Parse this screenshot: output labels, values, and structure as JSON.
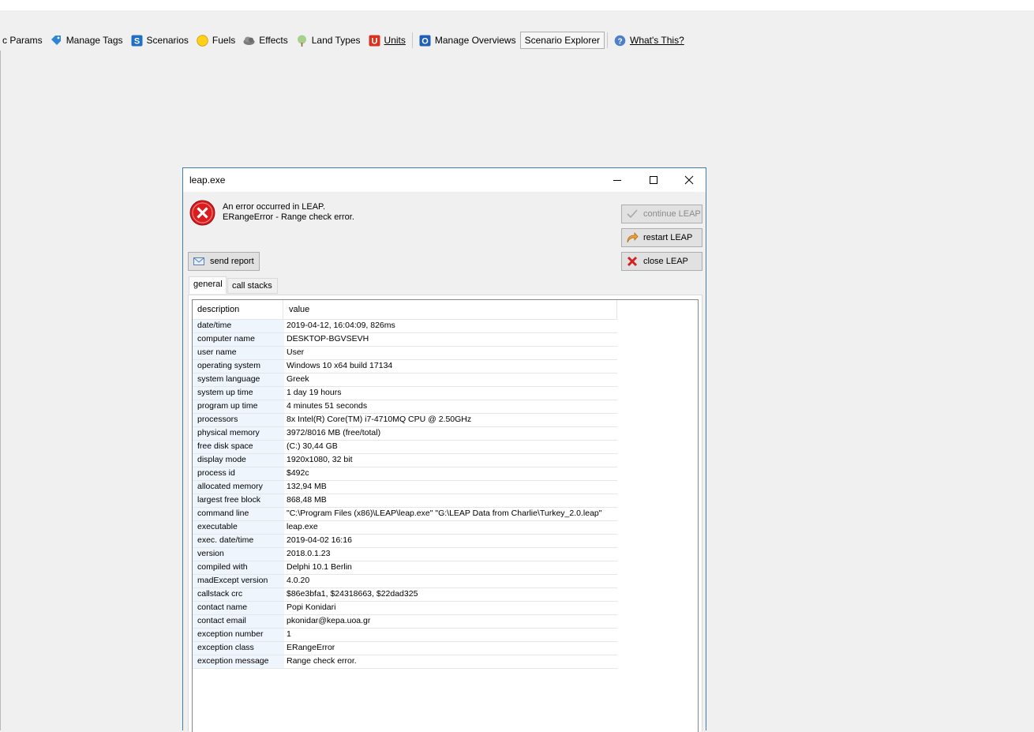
{
  "toolbar": {
    "items": [
      {
        "label": "c Params",
        "icon": "none"
      },
      {
        "label": "Manage Tags",
        "icon": "tag-icon"
      },
      {
        "label": "Scenarios",
        "icon": "scenarios-icon"
      },
      {
        "label": "Fuels",
        "icon": "fuels-icon"
      },
      {
        "label": "Effects",
        "icon": "effects-icon"
      },
      {
        "label": "Land Types",
        "icon": "tree-icon"
      },
      {
        "label": "Units",
        "icon": "units-icon"
      },
      {
        "label": "Manage Overviews",
        "icon": "overviews-icon"
      },
      {
        "label": "Scenario Explorer",
        "icon": "none"
      },
      {
        "label": "What's This?",
        "icon": "help-icon"
      }
    ]
  },
  "dialog": {
    "title": "leap.exe",
    "message_line1": "An error occurred in LEAP.",
    "message_line2": "ERangeError - Range check error.",
    "buttons": {
      "continue": "continue LEAP",
      "restart": "restart LEAP",
      "close": "close LEAP",
      "send_report": "send report"
    },
    "tabs": {
      "general": "general",
      "call_stacks": "call stacks"
    },
    "grid": {
      "header_description": "description",
      "header_value": "value",
      "rows": [
        {
          "k": "date/time",
          "v": "2019-04-12, 16:04:09, 826ms"
        },
        {
          "k": "computer name",
          "v": "DESKTOP-BGVSEVH"
        },
        {
          "k": "user name",
          "v": "User"
        },
        {
          "k": "operating system",
          "v": "Windows 10 x64 build 17134"
        },
        {
          "k": "system language",
          "v": "Greek"
        },
        {
          "k": "system up time",
          "v": "1 day 19 hours"
        },
        {
          "k": "program up time",
          "v": "4 minutes 51 seconds"
        },
        {
          "k": "processors",
          "v": "8x Intel(R) Core(TM) i7-4710MQ CPU @ 2.50GHz"
        },
        {
          "k": "physical memory",
          "v": "3972/8016 MB (free/total)"
        },
        {
          "k": "free disk space",
          "v": "(C:) 30,44 GB"
        },
        {
          "k": "display mode",
          "v": "1920x1080, 32 bit"
        },
        {
          "k": "process id",
          "v": "$492c"
        },
        {
          "k": "allocated memory",
          "v": "132,94 MB"
        },
        {
          "k": "largest free block",
          "v": "868,48 MB"
        },
        {
          "k": "command line",
          "v": "\"C:\\Program Files (x86)\\LEAP\\leap.exe\" \"G:\\LEAP Data from Charlie\\Turkey_2.0.leap\""
        },
        {
          "k": "executable",
          "v": "leap.exe"
        },
        {
          "k": "exec. date/time",
          "v": "2019-04-02 16:16"
        },
        {
          "k": "version",
          "v": "2018.0.1.23"
        },
        {
          "k": "compiled with",
          "v": "Delphi 10.1 Berlin"
        },
        {
          "k": "madExcept version",
          "v": "4.0.20"
        },
        {
          "k": "callstack crc",
          "v": "$86e3bfa1, $24318663, $22dad325"
        },
        {
          "k": "contact name",
          "v": "Popi Konidari"
        },
        {
          "k": "contact email",
          "v": "pkonidar@kepa.uoa.gr"
        },
        {
          "k": "exception number",
          "v": "1"
        },
        {
          "k": "exception class",
          "v": "ERangeError"
        },
        {
          "k": "exception message",
          "v": "Range check error."
        }
      ]
    }
  }
}
